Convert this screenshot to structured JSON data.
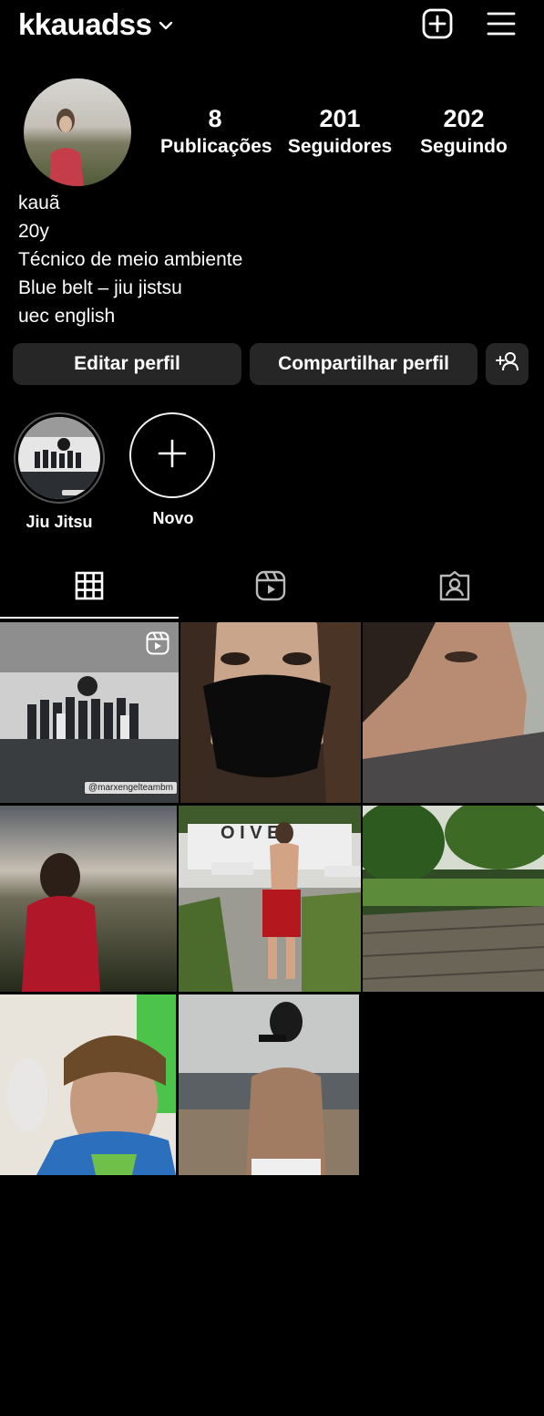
{
  "header": {
    "username": "kkauadss",
    "icons": {
      "dropdown": "chevron-down-icon",
      "create": "plus-square-icon",
      "menu": "hamburger-menu-icon"
    }
  },
  "profile": {
    "stats": [
      {
        "value": "8",
        "label": "Publicações"
      },
      {
        "value": "201",
        "label": "Seguidores"
      },
      {
        "value": "202",
        "label": "Seguindo"
      }
    ],
    "bio": [
      "kauã",
      "20y",
      "Técnico de meio ambiente",
      "Blue belt – jiu jistsu",
      "uec english"
    ]
  },
  "buttons": {
    "edit": "Editar perfil",
    "share": "Compartilhar perfil",
    "discover_icon": "add-person-icon"
  },
  "highlights": [
    {
      "label": "Jiu Jitsu"
    },
    {
      "label": "Novo"
    }
  ],
  "tabs": [
    "grid-icon",
    "reels-icon",
    "tagged-icon"
  ],
  "grid": {
    "post_count_shown": 8,
    "first_post_tag": "@marxengelteambm"
  },
  "colors": {
    "background": "#000000",
    "button_bg": "#262626",
    "text": "#ffffff"
  }
}
